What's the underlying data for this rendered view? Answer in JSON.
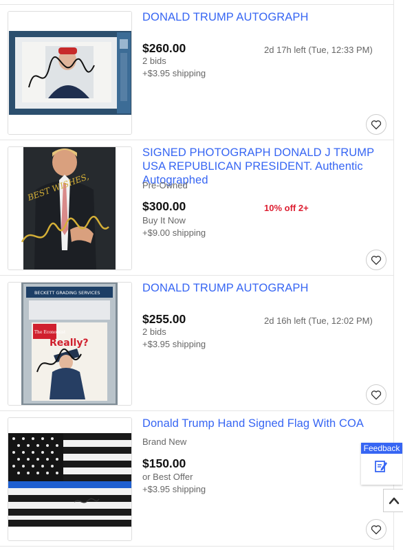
{
  "items": [
    {
      "title": "DONALD TRUMP AUTOGRAPH",
      "price": "$260.00",
      "format": "2 bids",
      "shipping": "+$3.95 shipping",
      "time_left": "2d 17h left (Tue, 12:33 PM)",
      "thumb_icon": "slabbed-signed-photo-image"
    },
    {
      "title": "SIGNED PHOTOGRAPH DONALD J TRUMP USA REPUBLICAN PRESIDENT. Authentic Autographed",
      "condition": "Pre-Owned",
      "price": "$300.00",
      "format": "Buy It Now",
      "shipping": "+$9.00 shipping",
      "promo": "10% off 2+",
      "thumb_icon": "signed-portrait-image",
      "thumb_text": "BEST WISHES,"
    },
    {
      "title": "DONALD TRUMP AUTOGRAPH",
      "price": "$255.00",
      "format": "2 bids",
      "shipping": "+$3.95 shipping",
      "time_left": "2d 16h left (Tue, 12:02 PM)",
      "thumb_icon": "slabbed-signed-magazine-image",
      "thumb_text": {
        "header": "BECKETT GRADING SERVICES",
        "masthead": "The Economist",
        "cover_line": "Really?"
      }
    },
    {
      "title": "Donald Trump Hand Signed Flag With COA",
      "condition": "Brand New",
      "price": "$150.00",
      "format": "or Best Offer",
      "shipping": "+$3.95 shipping",
      "thumb_icon": "thin-blue-line-flag-image"
    }
  ],
  "feedback": {
    "label": "Feedback",
    "icon": "edit-note-icon"
  },
  "back_to_top_icon": "chevron-up-icon",
  "watch_icon": "heart-icon",
  "colors": {
    "link": "#3665f3",
    "promo": "#dd1e31",
    "feedback_bg": "#3665f3"
  }
}
